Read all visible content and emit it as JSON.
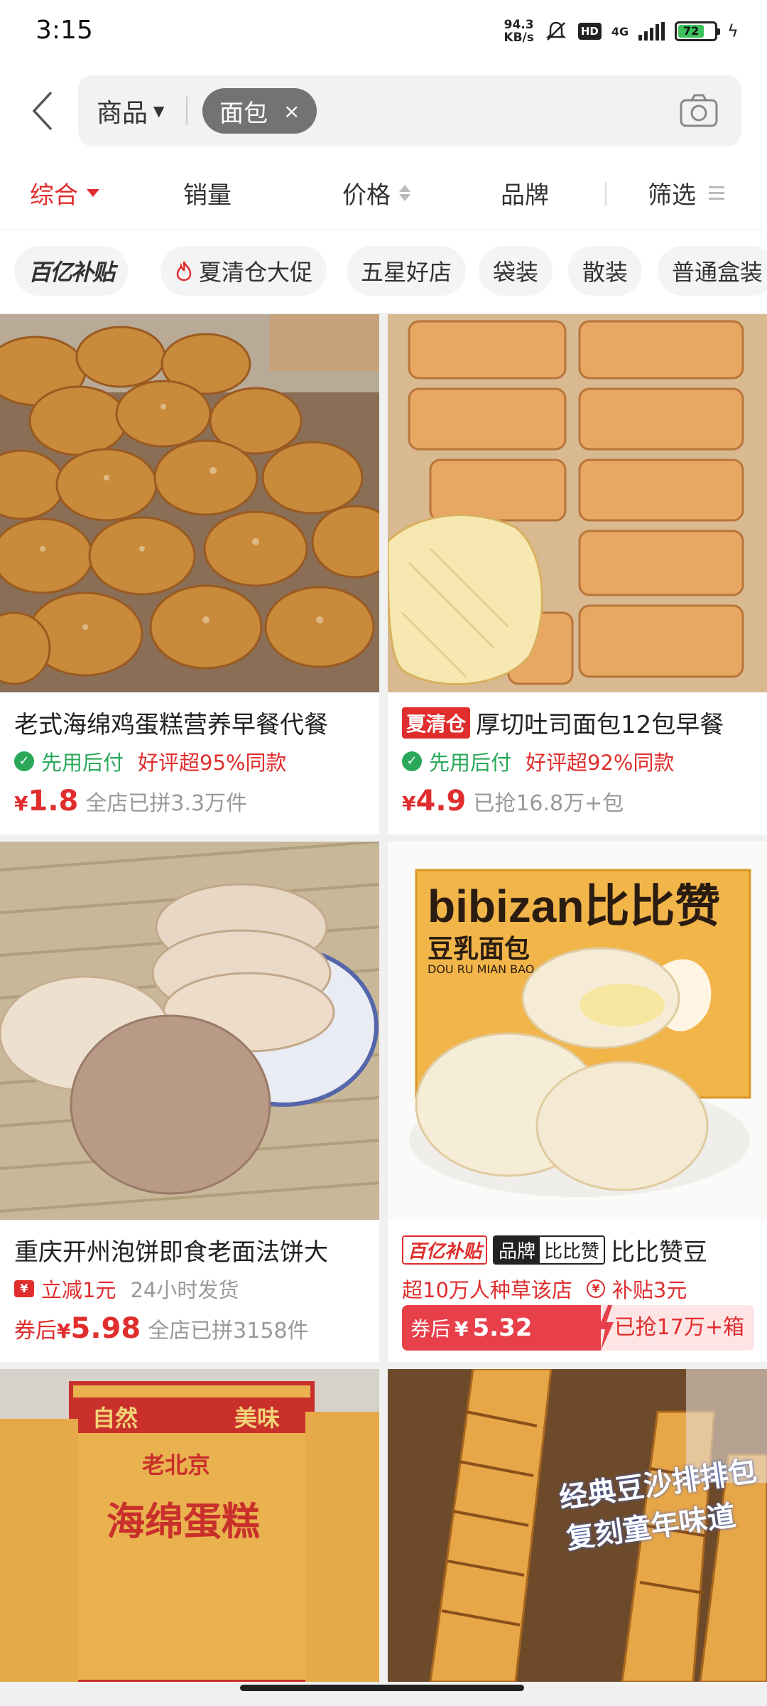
{
  "status": {
    "time": "3:15",
    "net_speed_value": "94.3",
    "net_speed_unit": "KB/s",
    "hd": "HD",
    "network": "4G",
    "battery": "72"
  },
  "search": {
    "scope_label": "商品",
    "query_chip": "面包",
    "chip_clear": "×"
  },
  "sort_tabs": {
    "overall": "综合",
    "sales": "销量",
    "price": "价格",
    "brand": "品牌",
    "filter": "筛选"
  },
  "quick_chips": [
    "百亿补贴",
    "夏清仓大促",
    "五星好店",
    "袋装",
    "散装",
    "普通盒装"
  ],
  "products": [
    {
      "title": "老式海绵鸡蛋糕营养早餐代餐",
      "pay_later": "先用后付",
      "review": "好评超95%同款",
      "currency": "¥",
      "price": "1.8",
      "sales": "全店已拼3.3万件"
    },
    {
      "tag": "夏清仓",
      "title": "厚切吐司面包12包早餐",
      "pay_later": "先用后付",
      "review": "好评超92%同款",
      "currency": "¥",
      "price": "4.9",
      "sales": "已抢16.8万+包"
    },
    {
      "title": "重庆开州泡饼即食老面法饼大",
      "discount": "立减1元",
      "shipping": "24小时发货",
      "coupon_prefix": "券后",
      "currency": "¥",
      "price": "5.98",
      "sales": "全店已拼3158件"
    },
    {
      "tag_subsidy": "百亿补贴",
      "brand_label": "品牌",
      "brand_name": "比比赞",
      "title": "比比赞豆",
      "grass": "超10万人种草该店",
      "subsidy": "补贴3元",
      "coupon_prefix": "券后",
      "currency": "¥",
      "price": "5.32",
      "sales": "已抢17万+箱"
    }
  ],
  "image_text": {
    "bibizan_brand": "bibizan",
    "bibizan_cn": "比比赞",
    "bibizan_product": "豆乳面包",
    "bibizan_pinyin": "DOU RU MIAN BAO",
    "bag_text_1": "自然",
    "bag_text_2": "美味",
    "bag_text_3": "老北京",
    "bag_text_4": "海绵蛋糕",
    "paiba_line1": "经典豆沙排排包",
    "paiba_line2": "复刻童年味道"
  },
  "colors": {
    "accent": "#e02d2d",
    "green": "#2aa85a",
    "chip_bg": "#737373"
  }
}
